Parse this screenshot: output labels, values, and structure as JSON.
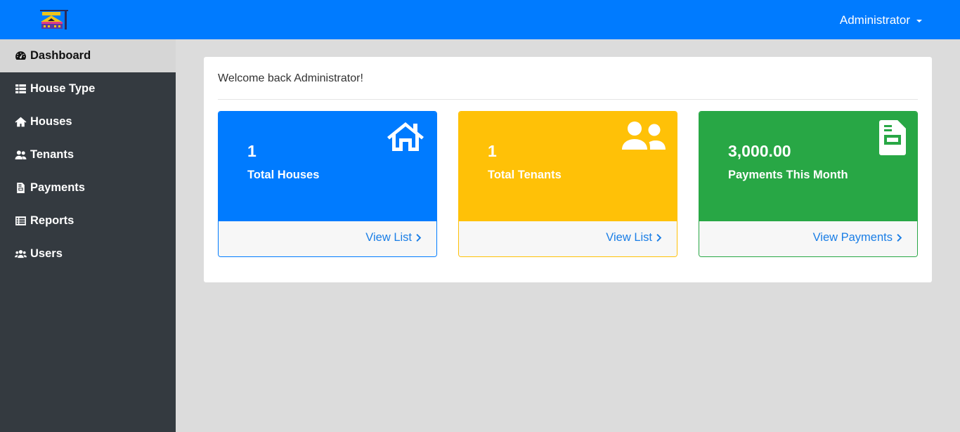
{
  "header": {
    "user_label": "Administrator"
  },
  "sidebar": {
    "items": [
      {
        "label": "Dashboard",
        "icon": "tachometer-icon",
        "active": true
      },
      {
        "label": "House Type",
        "icon": "list-icon"
      },
      {
        "label": "Houses",
        "icon": "home-icon"
      },
      {
        "label": "Tenants",
        "icon": "user-friends-icon"
      },
      {
        "label": "Payments",
        "icon": "file-invoice-icon"
      },
      {
        "label": "Reports",
        "icon": "list-alt-icon"
      },
      {
        "label": "Users",
        "icon": "users-icon"
      }
    ]
  },
  "main": {
    "welcome": "Welcome back Administrator!",
    "cards": [
      {
        "count": "1",
        "label": "Total Houses",
        "link": "View List",
        "icon": "home-icon",
        "color": "#007bff"
      },
      {
        "count": "1",
        "label": "Total Tenants",
        "link": "View List",
        "icon": "user-friends-icon",
        "color": "#ffc107"
      },
      {
        "count": "3,000.00",
        "label": "Payments This Month",
        "link": "View Payments",
        "icon": "file-invoice-icon",
        "color": "#28a745"
      }
    ]
  },
  "colors": {
    "primary": "#007bff",
    "warning": "#ffc107",
    "success": "#28a745",
    "sidebar": "#343a40"
  }
}
